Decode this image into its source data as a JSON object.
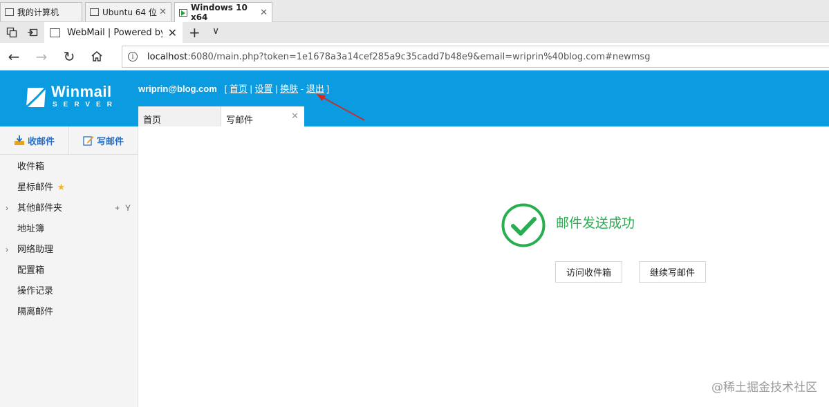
{
  "vm_tabs": [
    {
      "label": "我的计算机",
      "active": false
    },
    {
      "label": "Ubuntu 64 位",
      "active": false
    },
    {
      "label": "Windows 10 x64",
      "active": true
    }
  ],
  "browser": {
    "tab_title": "WebMail | Powered by V",
    "url_host": "localhost",
    "url_rest": ":6080/main.php?token=1e1678a3a14cef285a9c35cadd7b48e9&email=wriprin%40blog.com#newmsg"
  },
  "header": {
    "logo_text": "Winmail",
    "logo_sub": "SERVER",
    "user_email": "wriprin@blog.com",
    "links": {
      "open": "[",
      "home": "首页",
      "sep1": "|",
      "settings": "设置",
      "sep2": "|",
      "skin": "换肤",
      "sep3": "-",
      "logout": "退出",
      "close": "]"
    },
    "accent": "#0a9be0"
  },
  "tabs": {
    "home": "首页",
    "compose": "写邮件"
  },
  "sidebar": {
    "receive_label": "收邮件",
    "compose_label": "写邮件",
    "folders": [
      {
        "label": "收件箱"
      },
      {
        "label": "星标邮件"
      },
      {
        "label": "其他邮件夹"
      },
      {
        "label": "地址簿"
      },
      {
        "label": "网络助理"
      },
      {
        "label": "配置箱"
      },
      {
        "label": "操作记录"
      },
      {
        "label": "隔离邮件"
      }
    ]
  },
  "main": {
    "success_message": "邮件发送成功",
    "success_color": "#27ae4f",
    "buttons": {
      "visit_inbox": "访问收件箱",
      "continue_compose": "继续写邮件"
    }
  },
  "watermark": "@稀土掘金技术社区"
}
